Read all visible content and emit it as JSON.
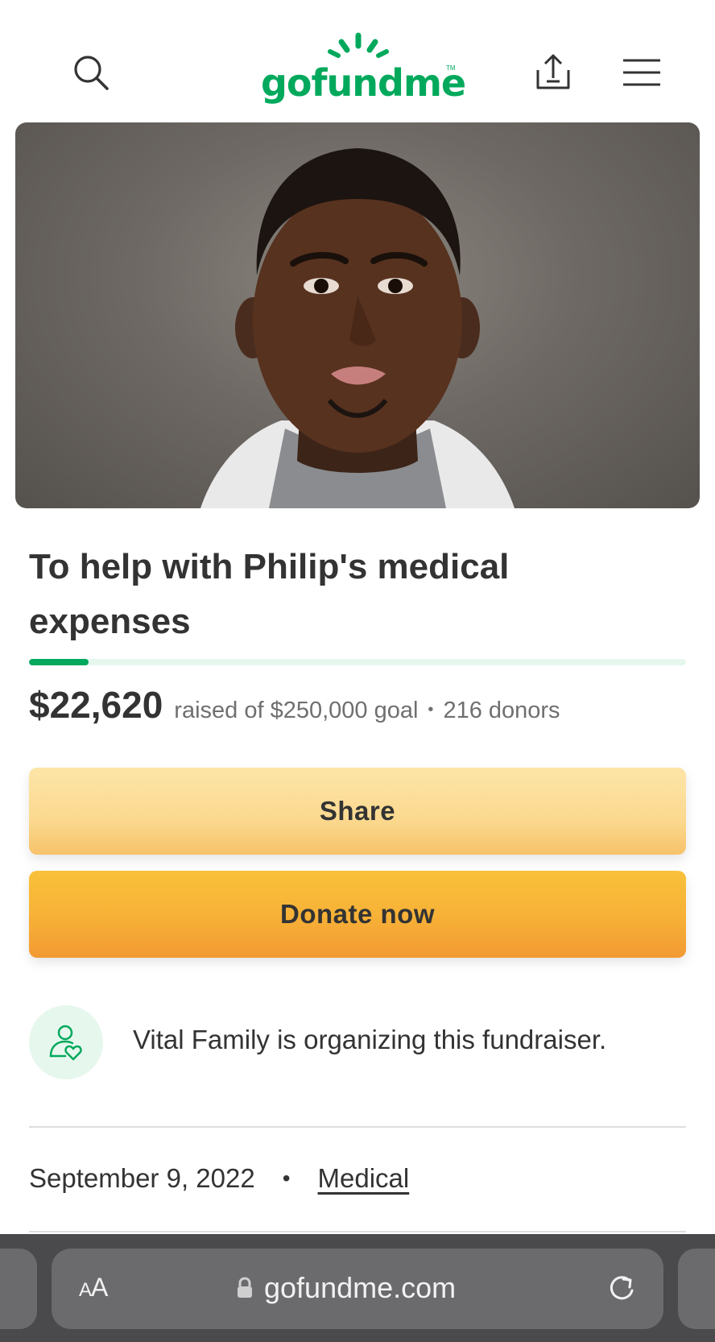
{
  "header": {
    "logo_text": "gofundme",
    "logo_tm": "TM",
    "brand_color": "#02a95c",
    "icons": [
      "search-icon",
      "share-upload-icon",
      "menu-icon"
    ]
  },
  "campaign": {
    "title": "To help with Philip's medical expenses",
    "raised": "$22,620",
    "raised_text": "raised of $250,000 goal",
    "separator": "•",
    "donors": "216 donors",
    "progress_fraction": 0.0905
  },
  "buttons": {
    "share_label": "Share",
    "donate_label": "Donate now"
  },
  "organizer": {
    "text": "Vital Family is organizing this fundraiser.",
    "icon": "organizer-heart-icon"
  },
  "meta": {
    "date": "September 9, 2022",
    "separator": "•",
    "category": "Medical"
  },
  "browser": {
    "aa_label_small": "A",
    "aa_label_large": "A",
    "url": "gofundme.com",
    "icons": [
      "lock-icon",
      "reload-icon"
    ]
  }
}
